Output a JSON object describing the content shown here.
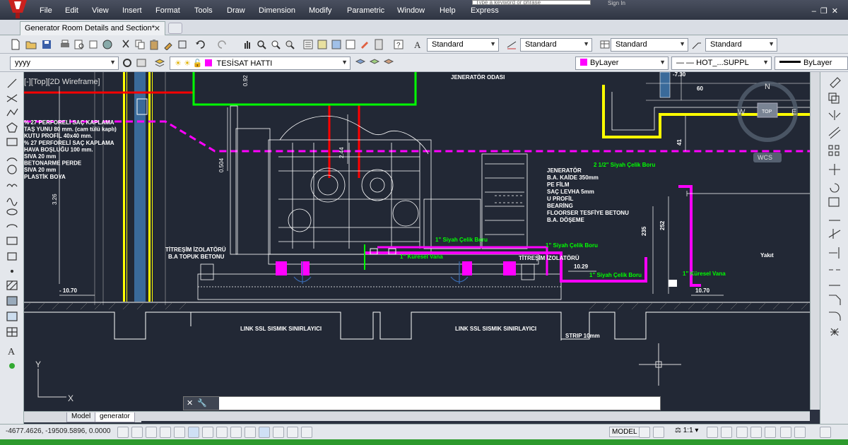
{
  "menubar": {
    "items": [
      "File",
      "Edit",
      "View",
      "Insert",
      "Format",
      "Tools",
      "Draw",
      "Dimension",
      "Modify",
      "Parametric",
      "Window",
      "Help",
      "Express"
    ],
    "search_placeholder": "Type a keyword or phrase",
    "signin": "Sign In"
  },
  "tabs": {
    "document": "Generator Room Details and Section*"
  },
  "toolbar": {
    "text_style": "Standard",
    "dim_style": "Standard",
    "table_style": "Standard",
    "mleader_style": "Standard",
    "workspace": "yyyy",
    "layer": "TESİSAT HATTI",
    "color": "ByLayer",
    "linetype": "HOT_...SUPPL",
    "lineweight": "ByLayer"
  },
  "viewport": {
    "label": "[-][Top][2D Wireframe]"
  },
  "drawing": {
    "title": "JENERATÖR ODASI",
    "yakit": "Yakıt",
    "left_notes": [
      "% 27 PERFORELİ SAÇ KAPLAMA",
      "TAŞ YUNU 80 mm. (cam tülü kaplı)",
      "KUTU PROFİL 40x40 mm.",
      "% 27 PERFORELİ SAÇ KAPLAMA",
      "HAVA BOŞLUĞU 100 mm.",
      "SIVA 20 mm",
      "BETONARME PERDE",
      "SIVA 20 mm",
      "PLASTİK BOYA"
    ],
    "right_notes": [
      "JENERATÖR",
      "B.A. KAİDE 350mm",
      "PE FİLM",
      "SAÇ LEVHA 5mm",
      "U PROFİL",
      "BEARİNG",
      "FLOORSER TESFİYE BETONU",
      "B.A. DÖŞEME"
    ],
    "labels": {
      "pipe_212": "2 1/2\" Siyah Çelik Boru",
      "pipe_1a": "1\" Siyah Çelik Boru",
      "pipe_1b": "1\" Siyah Çelik Boru",
      "pipe_1c": "1\" Siyah Çelik Boru",
      "valve_a": "1\" Küresel Vana",
      "valve_b": "1\" Küresel Vana",
      "titresim": "TİTREŞİM İZOLATÖRÜ",
      "titresim_small": "TİTREŞİM İZOLATÖRÜ",
      "topuk": "B.A TOPUK BETONU",
      "link1": "LINK SSL SISMIK SINIRLAYICI",
      "link2": "LINK SSL SISMIK SINIRLAYICI",
      "strip": "STRIP 10mm"
    },
    "dims": {
      "d326": "3.26",
      "d0504": "0.504",
      "d244": "2.44",
      "d092": "0.92",
      "d235": "235",
      "d252": "252",
      "d41": "41",
      "d1029": "10.29",
      "d1070a": "- 10.70",
      "d1070b": "10.70",
      "d730": "-7.30",
      "d60": "60"
    },
    "viewcube": {
      "n": "N",
      "e": "E",
      "w": "W",
      "top": "TOP",
      "wcs": "WCS"
    },
    "ucs": {
      "y": "Y",
      "x": "X"
    }
  },
  "layout_tabs": {
    "model": "Model",
    "generator": "generator"
  },
  "status": {
    "coords": "-4677.4626, -19509.5896, 0.0000",
    "model": "MODEL",
    "scale": "1:1"
  },
  "colors": {
    "background": "#222835",
    "magenta": "#ff00ff",
    "yellow": "#ffff00",
    "green": "#00ff00",
    "red": "#ff0000"
  }
}
